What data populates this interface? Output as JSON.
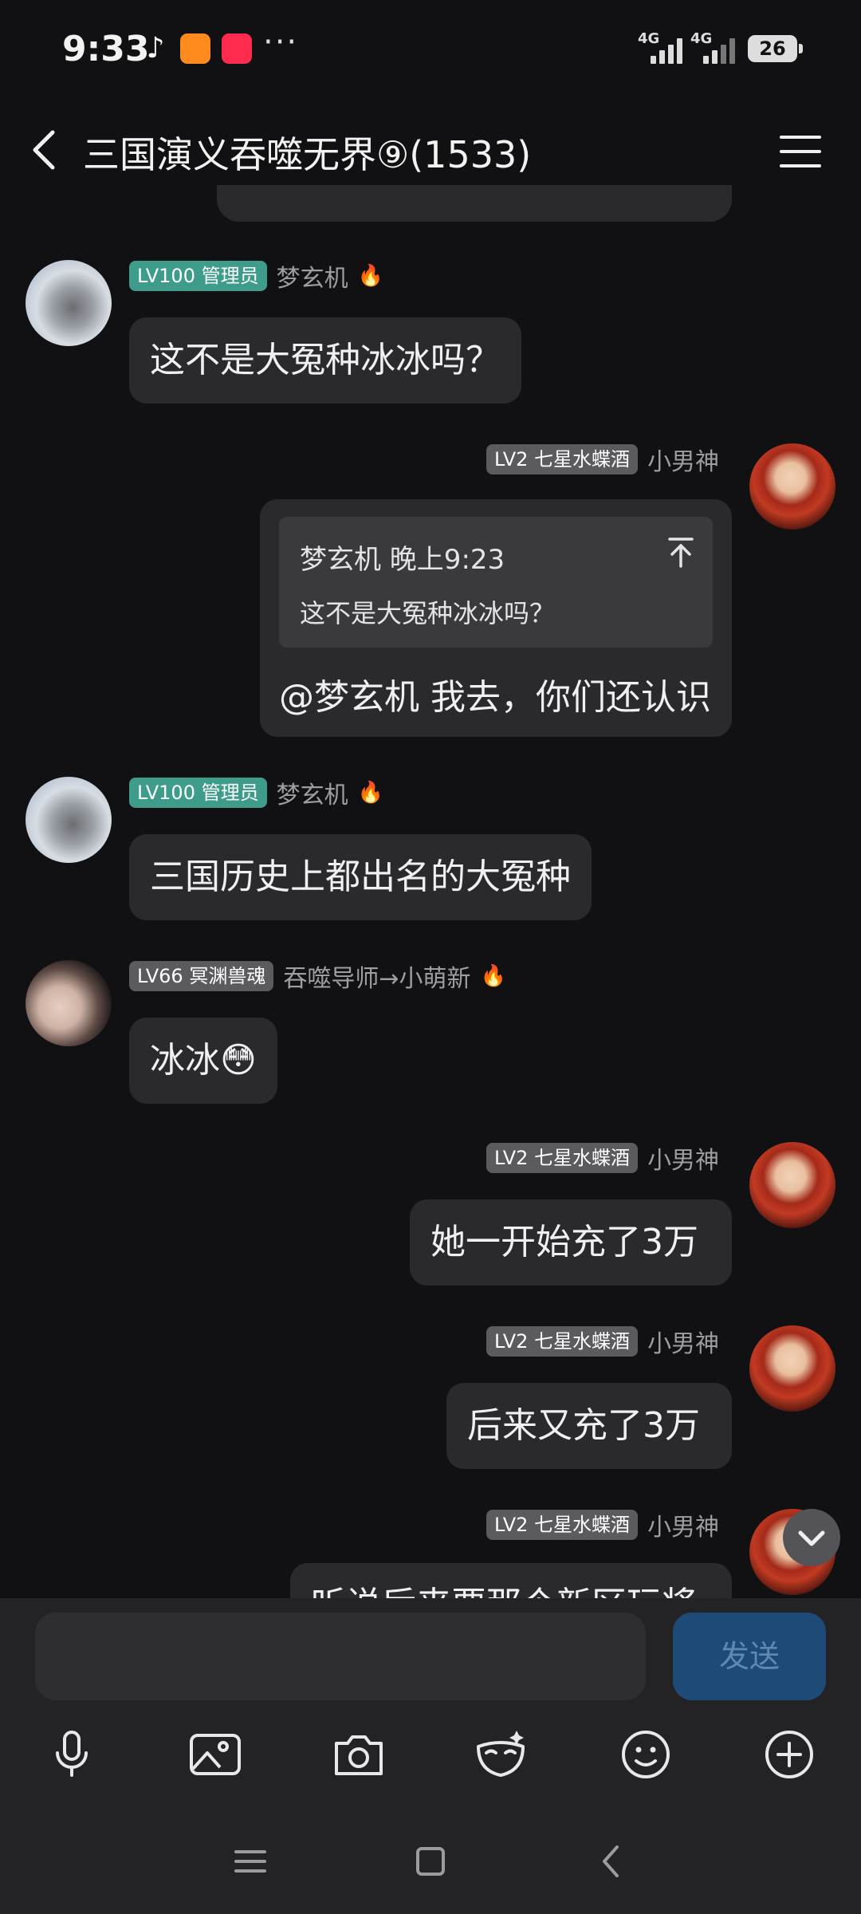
{
  "status_bar": {
    "time": "9:33",
    "network1": "4G",
    "network2": "4G",
    "battery": "26",
    "more": "···"
  },
  "header": {
    "title": "三国演义吞噬无界⑨(1533)"
  },
  "messages": [
    {
      "badge": "LV100 管理员",
      "name": "梦玄机",
      "text": "这不是大冤种冰冰吗？"
    },
    {
      "badge": "LV2 七星水蝶酒",
      "name": "小男神",
      "quote_header": "梦玄机 晚上9:23",
      "quote_text": "这不是大冤种冰冰吗？",
      "text": "@梦玄机 我去，你们还认识"
    },
    {
      "badge": "LV100 管理员",
      "name": "梦玄机",
      "text": "三国历史上都出名的大冤种"
    },
    {
      "badge": "LV66 冥渊兽魂",
      "name": "吞噬导师→小萌新",
      "text": "冰冰",
      "emoji": "😳"
    },
    {
      "badge": "LV2 七星水蝶酒",
      "name": "小男神",
      "text": "她一开始充了3万"
    },
    {
      "badge": "LV2 七星水蝶酒",
      "name": "小男神",
      "text": "后来又充了3万"
    },
    {
      "badge": "LV2 七星水蝶酒",
      "name": "小男神",
      "text": "听说后来要那个新区玩将"
    }
  ],
  "input": {
    "placeholder": "",
    "send_label": "发送"
  },
  "colors": {
    "background": "#111113",
    "bubble": "#2a2a2d",
    "admin_badge": "#3e9c8a",
    "level_badge": "#5a5a5f",
    "send_button": "#1e4a77"
  }
}
